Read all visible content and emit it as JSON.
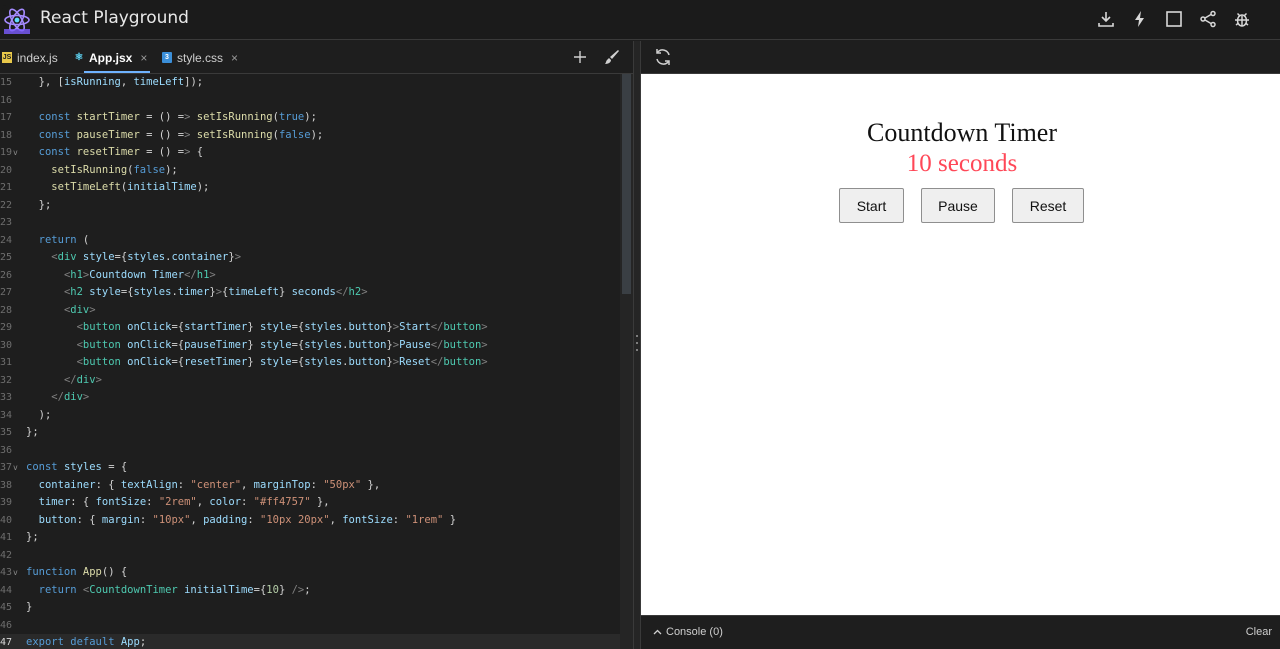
{
  "header": {
    "title": "React Playground",
    "actions": [
      "download-icon",
      "lightning-icon",
      "fullscreen-icon",
      "share-icon",
      "bug-icon"
    ]
  },
  "tabs": [
    {
      "label": "index.js",
      "icon": "js-file-icon",
      "active": false,
      "closable": false
    },
    {
      "label": "App.jsx",
      "icon": "jsx-file-icon",
      "active": true,
      "closable": true
    },
    {
      "label": "style.css",
      "icon": "css-file-icon",
      "active": false,
      "closable": true
    }
  ],
  "tab_close_glyph": "×",
  "editor": {
    "current_line": "47",
    "lines": [
      {
        "n": "15",
        "t": "  }, [isRunning, timeLeft]);"
      },
      {
        "n": "16",
        "t": ""
      },
      {
        "n": "17",
        "t": "  const startTimer = () => setIsRunning(true);"
      },
      {
        "n": "18",
        "t": "  const pauseTimer = () => setIsRunning(false);"
      },
      {
        "n": "19",
        "t": "  const resetTimer = () => {",
        "fold": true
      },
      {
        "n": "20",
        "t": "    setIsRunning(false);"
      },
      {
        "n": "21",
        "t": "    setTimeLeft(initialTime);"
      },
      {
        "n": "22",
        "t": "  };"
      },
      {
        "n": "23",
        "t": ""
      },
      {
        "n": "24",
        "t": "  return ("
      },
      {
        "n": "25",
        "t": "    <div style={styles.container}>"
      },
      {
        "n": "26",
        "t": "      <h1>Countdown Timer</h1>"
      },
      {
        "n": "27",
        "t": "      <h2 style={styles.timer}>{timeLeft} seconds</h2>"
      },
      {
        "n": "28",
        "t": "      <div>"
      },
      {
        "n": "29",
        "t": "        <button onClick={startTimer} style={styles.button}>Start</button>"
      },
      {
        "n": "30",
        "t": "        <button onClick={pauseTimer} style={styles.button}>Pause</button>"
      },
      {
        "n": "31",
        "t": "        <button onClick={resetTimer} style={styles.button}>Reset</button>"
      },
      {
        "n": "32",
        "t": "      </div>"
      },
      {
        "n": "33",
        "t": "    </div>"
      },
      {
        "n": "34",
        "t": "  );"
      },
      {
        "n": "35",
        "t": "};"
      },
      {
        "n": "36",
        "t": ""
      },
      {
        "n": "37",
        "t": "const styles = {",
        "fold": true
      },
      {
        "n": "38",
        "t": "  container: { textAlign: \"center\", marginTop: \"50px\" },"
      },
      {
        "n": "39",
        "t": "  timer: { fontSize: \"2rem\", color: \"#ff4757\" },"
      },
      {
        "n": "40",
        "t": "  button: { margin: \"10px\", padding: \"10px 20px\", fontSize: \"1rem\" }"
      },
      {
        "n": "41",
        "t": "};"
      },
      {
        "n": "42",
        "t": ""
      },
      {
        "n": "43",
        "t": "function App() {",
        "fold": true
      },
      {
        "n": "44",
        "t": "  return <CountdownTimer initialTime={10} />;"
      },
      {
        "n": "45",
        "t": "}"
      },
      {
        "n": "46",
        "t": ""
      },
      {
        "n": "47",
        "t": "export default App;"
      }
    ]
  },
  "preview": {
    "heading": "Countdown Timer",
    "timer_text": "10 seconds",
    "timer_color": "#ff4757",
    "buttons": [
      "Start",
      "Pause",
      "Reset"
    ]
  },
  "console": {
    "label": "Console (0)",
    "clear_label": "Clear"
  },
  "colors": {
    "accent": "#6fb3ff",
    "react": "#61dafb"
  }
}
